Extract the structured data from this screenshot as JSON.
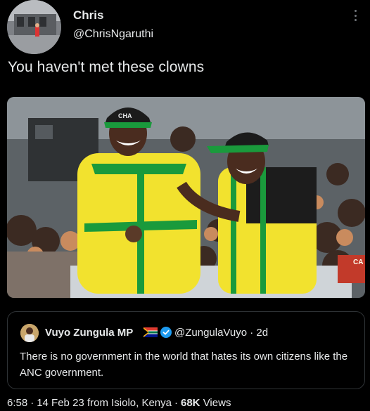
{
  "author": {
    "display_name": "Chris",
    "handle": "@ChrisNgaruthi"
  },
  "tweet": {
    "text": "You haven't met these clowns"
  },
  "icons": {
    "more": "more-vertical-icon",
    "verified": "verified-badge-icon",
    "flag": "south-africa-flag-icon"
  },
  "quoted_tweet": {
    "display_name": "Vuyo Zungula MP",
    "handle": "@ZungulaVuyo",
    "separator": "·",
    "time": "2d",
    "text": "There is no government in the world  that hates its own citizens like the ANC government."
  },
  "photo": {
    "cap_text": "CHA",
    "bumper_text": "CA"
  },
  "meta": {
    "time": "6:58",
    "date": "14 Feb 23",
    "location": "from Isiolo, Kenya",
    "separator": "·",
    "views_count": "68K",
    "views_label": "Views"
  },
  "colors": {
    "background": "#000000",
    "text": "#e7e9ea",
    "border": "#2f3336",
    "verified": "#1d9bf0",
    "shirt_yellow": "#f2e22e",
    "shirt_green": "#1a9a3c"
  }
}
